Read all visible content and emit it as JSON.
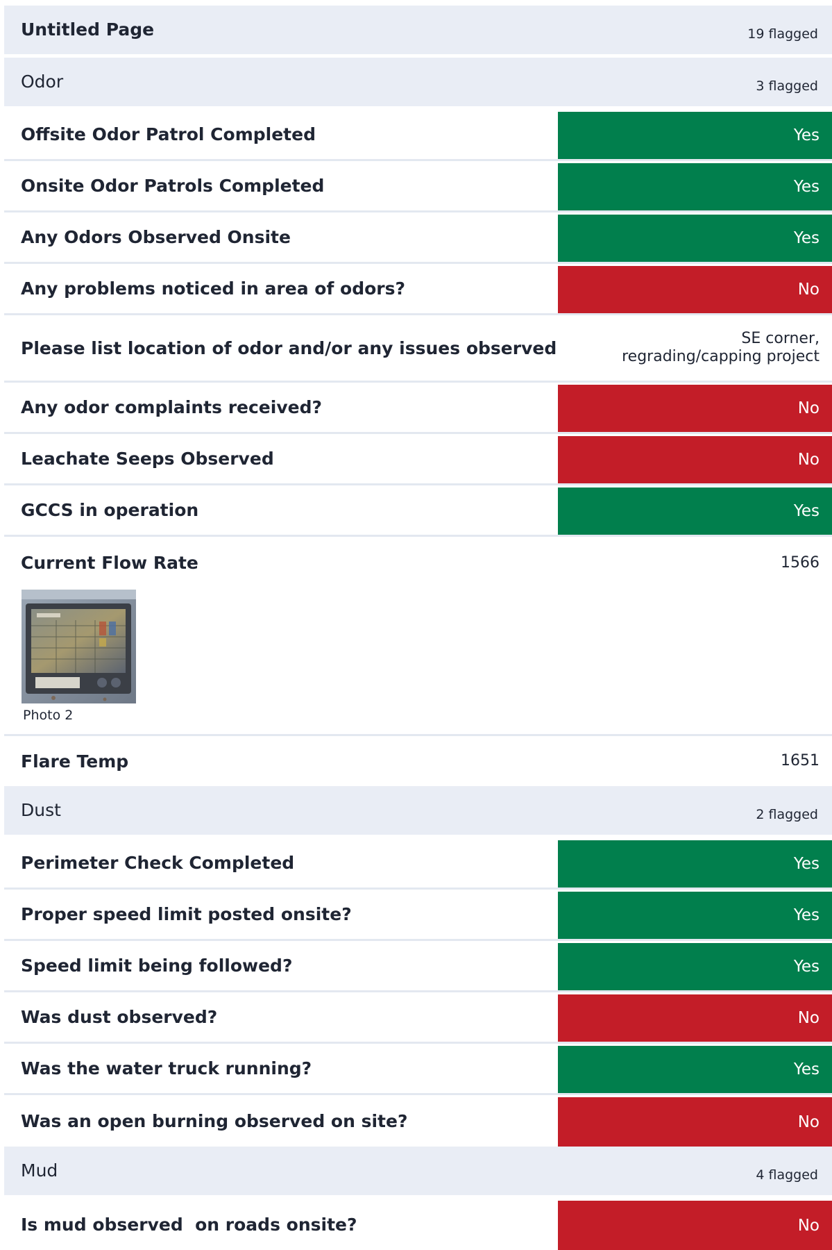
{
  "page": {
    "title": "Untitled Page",
    "flagged": "19 flagged"
  },
  "sections": {
    "odor": {
      "title": "Odor",
      "flagged": "3 flagged",
      "items": [
        {
          "label": "Offsite Odor Patrol Completed",
          "value": "Yes"
        },
        {
          "label": "Onsite Odor Patrols Completed",
          "value": "Yes"
        },
        {
          "label": "Any Odors Observed Onsite",
          "value": "Yes"
        },
        {
          "label": "Any problems noticed in area of odors?",
          "value": "No"
        },
        {
          "label": "Please list location of odor and/or any issues observed",
          "value": "SE corner, regrading/capping project"
        },
        {
          "label": "Any odor complaints received?",
          "value": "No"
        },
        {
          "label": "Leachate Seeps Observed",
          "value": "No"
        },
        {
          "label": "GCCS in operation",
          "value": "Yes"
        },
        {
          "label": "Current Flow Rate",
          "value": "1566",
          "photo_caption": "Photo 2"
        },
        {
          "label": "Flare Temp",
          "value": "1651"
        }
      ]
    },
    "dust": {
      "title": "Dust",
      "flagged": "2 flagged",
      "items": [
        {
          "label": "Perimeter Check Completed",
          "value": "Yes"
        },
        {
          "label": "Proper speed limit posted onsite?",
          "value": "Yes"
        },
        {
          "label": "Speed limit being followed?",
          "value": "Yes"
        },
        {
          "label": "Was dust observed?",
          "value": "No"
        },
        {
          "label": "Was the water truck running?",
          "value": "Yes"
        },
        {
          "label": "Was an open burning observed on site?",
          "value": "No"
        }
      ]
    },
    "mud": {
      "title": "Mud",
      "flagged": "4 flagged",
      "items": [
        {
          "label": "Is mud observed  on roads onsite?",
          "value": "No"
        }
      ]
    }
  },
  "colors": {
    "yes": "#017f4d",
    "no": "#c31d28",
    "header_bg": "#e9edf5"
  }
}
